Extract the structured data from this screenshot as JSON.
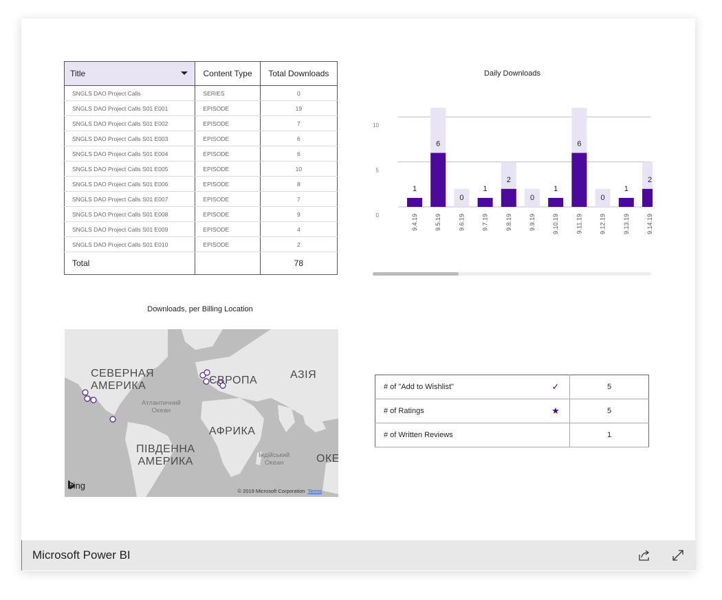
{
  "table": {
    "headers": [
      "Title",
      "Content Type",
      "Total Downloads"
    ],
    "rows": [
      [
        "SNGLS DAO Project Calls",
        "SERIES",
        "0"
      ],
      [
        "SNGLS DAO Project Calls S01 E001",
        "EPISODE",
        "19"
      ],
      [
        "SNGLS DAO Project Calls S01 E002",
        "EPISODE",
        "7"
      ],
      [
        "SNGLS DAO Project Calls S01 E003",
        "EPISODE",
        "6"
      ],
      [
        "SNGLS DAO Project Calls S01 E004",
        "EPISODE",
        "6"
      ],
      [
        "SNGLS DAO Project Calls S01 E005",
        "EPISODE",
        "10"
      ],
      [
        "SNGLS DAO Project Calls S01 E006",
        "EPISODE",
        "8"
      ],
      [
        "SNGLS DAO Project Calls S01 E007",
        "EPISODE",
        "7"
      ],
      [
        "SNGLS DAO Project Calls S01 E008",
        "EPISODE",
        "9"
      ],
      [
        "SNGLS DAO Project Calls S01 E009",
        "EPISODE",
        "4"
      ],
      [
        "SNGLS DAO Project Calls S01 E010",
        "EPISODE",
        "2"
      ]
    ],
    "total_label": "Total",
    "total_value": "78"
  },
  "chart_data": {
    "type": "bar",
    "title": "Daily Downloads",
    "categories": [
      "9.4.19",
      "9.5.19",
      "9.6.19",
      "9.7.19",
      "9.8.19",
      "9.9.19",
      "9.10.19",
      "9.11.19",
      "9.12.19",
      "9.13.19",
      "9.14.19"
    ],
    "values": [
      1,
      6,
      0,
      1,
      2,
      0,
      1,
      6,
      0,
      1,
      2
    ],
    "background_values": [
      0,
      11,
      2,
      0,
      5,
      2,
      0,
      11,
      2,
      0,
      5
    ],
    "yticks": [
      "0",
      "5",
      "10"
    ],
    "ylim": [
      0,
      11
    ],
    "colors": {
      "bar": "#4b0a9b",
      "background_bar": "#e9e4f3",
      "grid": "#bdbdbd"
    }
  },
  "map": {
    "title": "Downloads, per Billing Location",
    "labels": {
      "north_america": "СЕВЕРНАЯ\nАМЕРИКА",
      "europe": "ЄВРОПА",
      "asia": "АЗІЯ",
      "atlantic": "Атлантичний\nОкеан",
      "africa": "АФРИКА",
      "south_america": "ПІВДЕННА\nАМЕРИКА",
      "indian": "Індійський\nОкеан",
      "ocean_cut": "ОКЕ"
    },
    "bing": "Bing",
    "copyright": "© 2019 Microsoft Corporation",
    "terms": "Terms"
  },
  "metrics": {
    "rows": [
      {
        "label": "# of \"Add to Wishlist\"",
        "icon": "checkmark-icon",
        "glyph": "✓",
        "value": "5"
      },
      {
        "label": "# of Ratings",
        "icon": "star-icon",
        "glyph": "★",
        "value": "5"
      },
      {
        "label": "# of Written Reviews",
        "icon": "",
        "glyph": "",
        "value": "1"
      }
    ]
  },
  "footer": {
    "brand": "Microsoft Power BI",
    "share_icon": "share-icon",
    "expand_icon": "expand-icon"
  }
}
